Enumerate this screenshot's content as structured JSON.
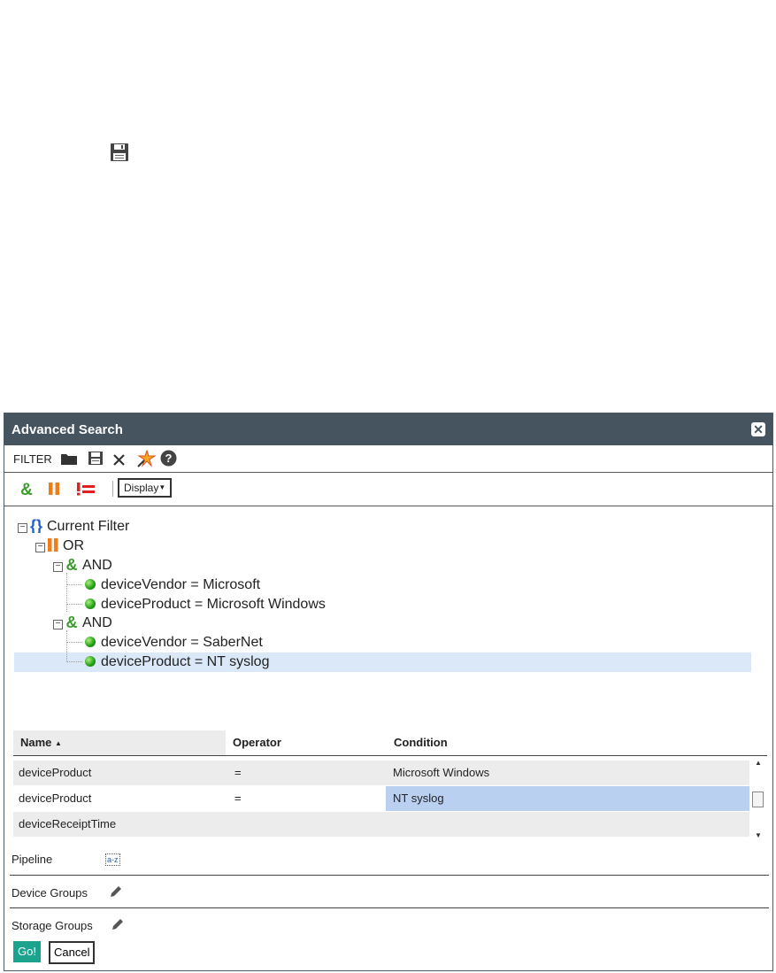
{
  "dialog": {
    "title": "Advanced Search"
  },
  "toolbar": {
    "filter_label": "FILTER",
    "display_label": "Display"
  },
  "tree": {
    "root": "Current Filter",
    "or_label": "OR",
    "and1_label": "AND",
    "and1_items": [
      "deviceVendor = Microsoft",
      "deviceProduct = Microsoft Windows"
    ],
    "and2_label": "AND",
    "and2_items": [
      "deviceVendor = SaberNet",
      "deviceProduct = NT syslog"
    ]
  },
  "grid": {
    "headers": [
      "Name",
      "Operator",
      "Condition"
    ],
    "sort_indicator": "▲",
    "rows": [
      {
        "name": "deviceProduct",
        "operator": "=",
        "condition": "Microsoft Windows"
      },
      {
        "name": "deviceProduct",
        "operator": "=",
        "condition": "NT syslog"
      },
      {
        "name": "deviceReceiptTime",
        "operator": "",
        "condition": ""
      }
    ]
  },
  "sections": {
    "pipeline": "Pipeline",
    "az": "a-z",
    "device_groups": "Device Groups",
    "storage_groups": "Storage Groups"
  },
  "buttons": {
    "go": "Go!",
    "cancel": "Cancel"
  },
  "colors": {
    "titlebar": "#45545f",
    "and_green": "#3a9c2a",
    "or_orange": "#ef7d1a",
    "not_red": "#e02020",
    "brace_blue": "#1f5fc8",
    "go_teal": "#1ba38e",
    "selected_row": "#dbe8f8",
    "selected_cell": "#b9d0f0"
  }
}
